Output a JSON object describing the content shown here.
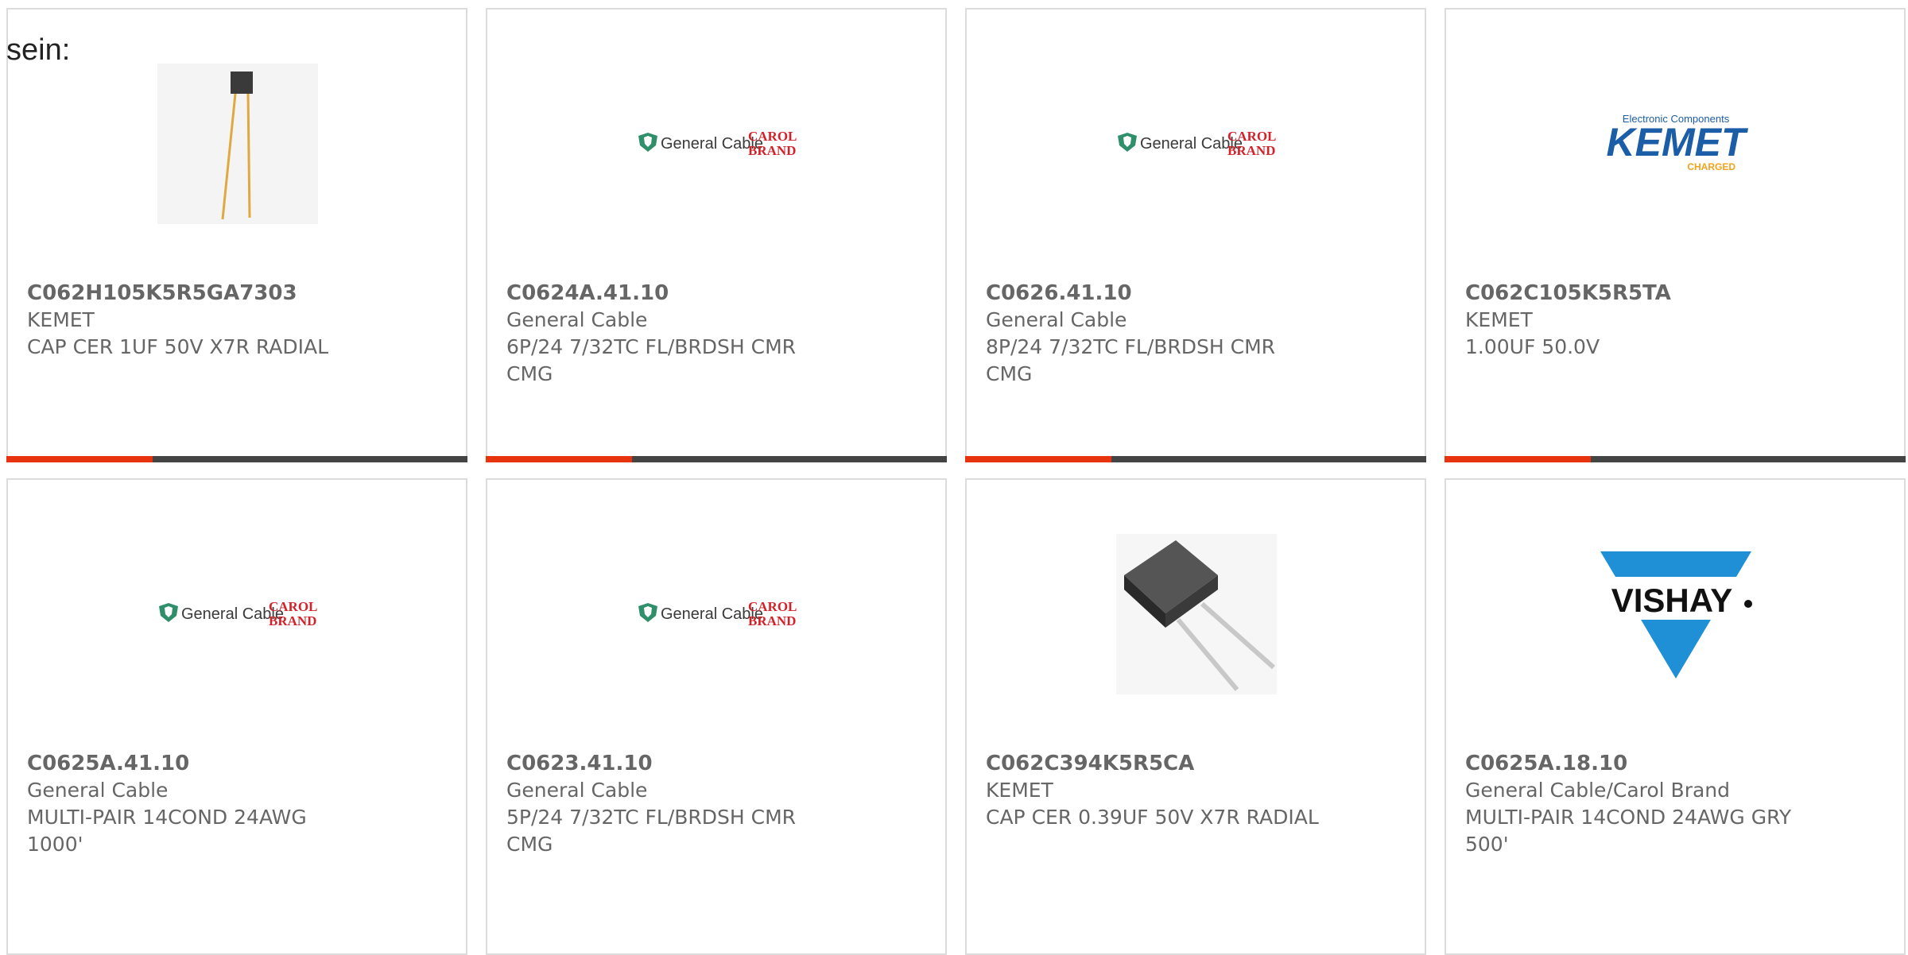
{
  "intro_text": "sein:",
  "colors": {
    "accent": "#e8330f",
    "bar": "#444444",
    "border": "#dcdcdc",
    "text": "#666666",
    "gc_green": "#2f8f6a",
    "carol_red": "#d2232a",
    "kemet_blue": "#1c5da8",
    "kemet_orange": "#f2a31b",
    "vishay_blue": "#1f8fd6"
  },
  "logos": {
    "general_cable": "General Cable",
    "carol_top": "CAROL",
    "carol_bottom": "BRAND",
    "kemet_top": "Electronic Components",
    "kemet": "KEMET",
    "kemet_bottom": "CHARGED",
    "vishay": "VISHAY"
  },
  "products": [
    {
      "part": "C062H105K5R5GA7303",
      "maker": "KEMET",
      "desc": "CAP CER 1UF 50V X7R RADIAL",
      "image": "capacitor-radial-icon"
    },
    {
      "part": "C0624A.41.10",
      "maker": "General Cable",
      "desc": "6P/24 7/32TC FL/BRDSH CMR CMG",
      "image": "general-cable-logo"
    },
    {
      "part": "C0626.41.10",
      "maker": "General Cable",
      "desc": "8P/24 7/32TC FL/BRDSH CMR CMG",
      "image": "general-cable-logo"
    },
    {
      "part": "C062C105K5R5TA",
      "maker": "KEMET",
      "desc": "1.00UF 50.0V",
      "image": "kemet-logo"
    },
    {
      "part": "C0625A.41.10",
      "maker": "General Cable",
      "desc": "MULTI-PAIR 14COND 24AWG 1000'",
      "image": "general-cable-logo"
    },
    {
      "part": "C0623.41.10",
      "maker": "General Cable",
      "desc": "5P/24 7/32TC FL/BRDSH CMR CMG",
      "image": "general-cable-logo"
    },
    {
      "part": "C062C394K5R5CA",
      "maker": "KEMET",
      "desc": "CAP CER 0.39UF 50V X7R RADIAL",
      "image": "capacitor-block-icon"
    },
    {
      "part": "C0625A.18.10",
      "maker": "General Cable/Carol Brand",
      "desc": "MULTI-PAIR 14COND 24AWG GRY 500'",
      "image": "vishay-logo"
    }
  ]
}
